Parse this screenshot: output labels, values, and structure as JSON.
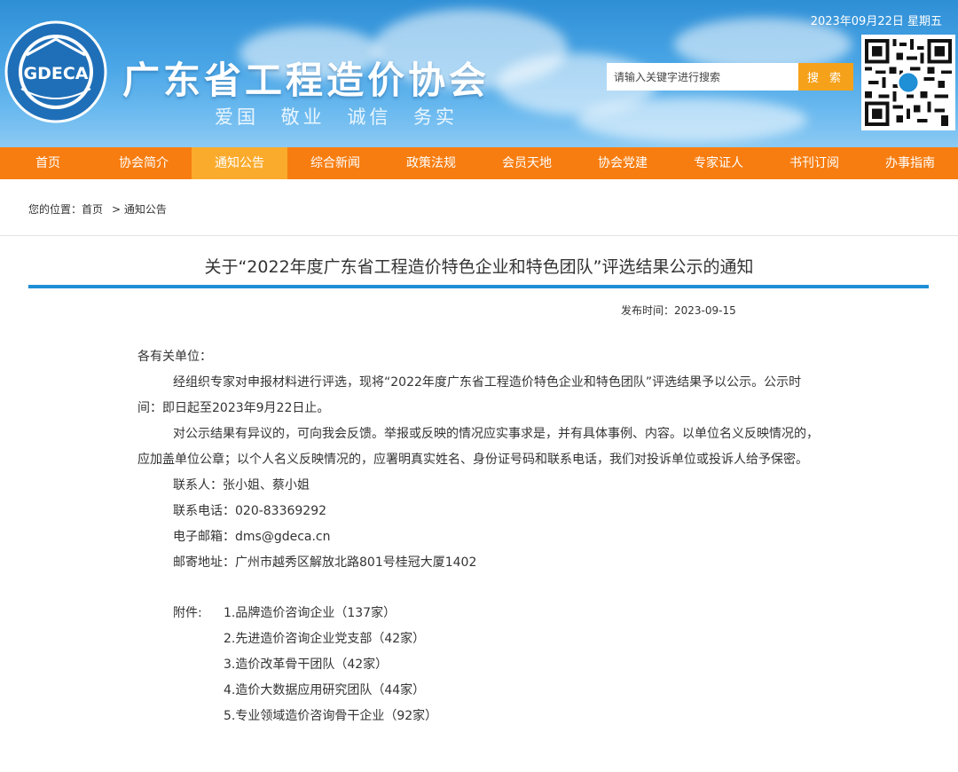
{
  "header": {
    "date": "2023年09月22日 星期五",
    "site_title": "广东省工程造价协会",
    "slogan": "爱国 敬业 诚信 务实",
    "logo_text": "GDECA",
    "search_placeholder": "请输入关键字进行搜索",
    "search_button": "搜 索",
    "colors": {
      "header_blue": "#3a9ae0",
      "accent_orange": "#f77d10",
      "active_tab": "#fbab2c",
      "rule_blue": "#1e8fd5"
    }
  },
  "nav": {
    "items": [
      "首页",
      "协会简介",
      "通知公告",
      "综合新闻",
      "政策法规",
      "会员天地",
      "协会党建",
      "专家证人",
      "书刊订阅",
      "办事指南"
    ],
    "active": "通知公告"
  },
  "breadcrumb": {
    "label": "您的位置：首页",
    "current": "> 通知公告"
  },
  "article": {
    "title": "关于“2022年度广东省工程造价特色企业和特色团队”评选结果公示的通知",
    "pubtime": "发布时间：2023-09-15",
    "salutation": "各有关单位：",
    "para1": "经组织专家对申报材料进行评选，现将“2022年度广东省工程造价特色企业和特色团队”评选结果予以公示。公示时间：即日起至2023年9月22日止。",
    "para2": "对公示结果有异议的，可向我会反馈。举报或反映的情况应实事求是，并有具体事例、内容。以单位名义反映情况的，应加盖单位公章；以个人名义反映情况的，应署明真实姓名、身份证号码和联系电话，我们对投诉单位或投诉人给予保密。",
    "contact": "联系人：张小姐、蔡小姐",
    "phone": "联系电话：020-83369292",
    "email": "电子邮箱：dms@gdeca.cn",
    "address": "邮寄地址：广州市越秀区解放北路801号桂冠大厦1402",
    "attachments_label": "附件:",
    "attachments": [
      "1.品牌造价咨询企业（137家）",
      "2.先进造价咨询企业党支部（42家）",
      "3.造价改革骨干团队（42家）",
      "4.造价大数据应用研究团队（44家）",
      "5.专业领域造价咨询骨干企业（92家）"
    ]
  }
}
